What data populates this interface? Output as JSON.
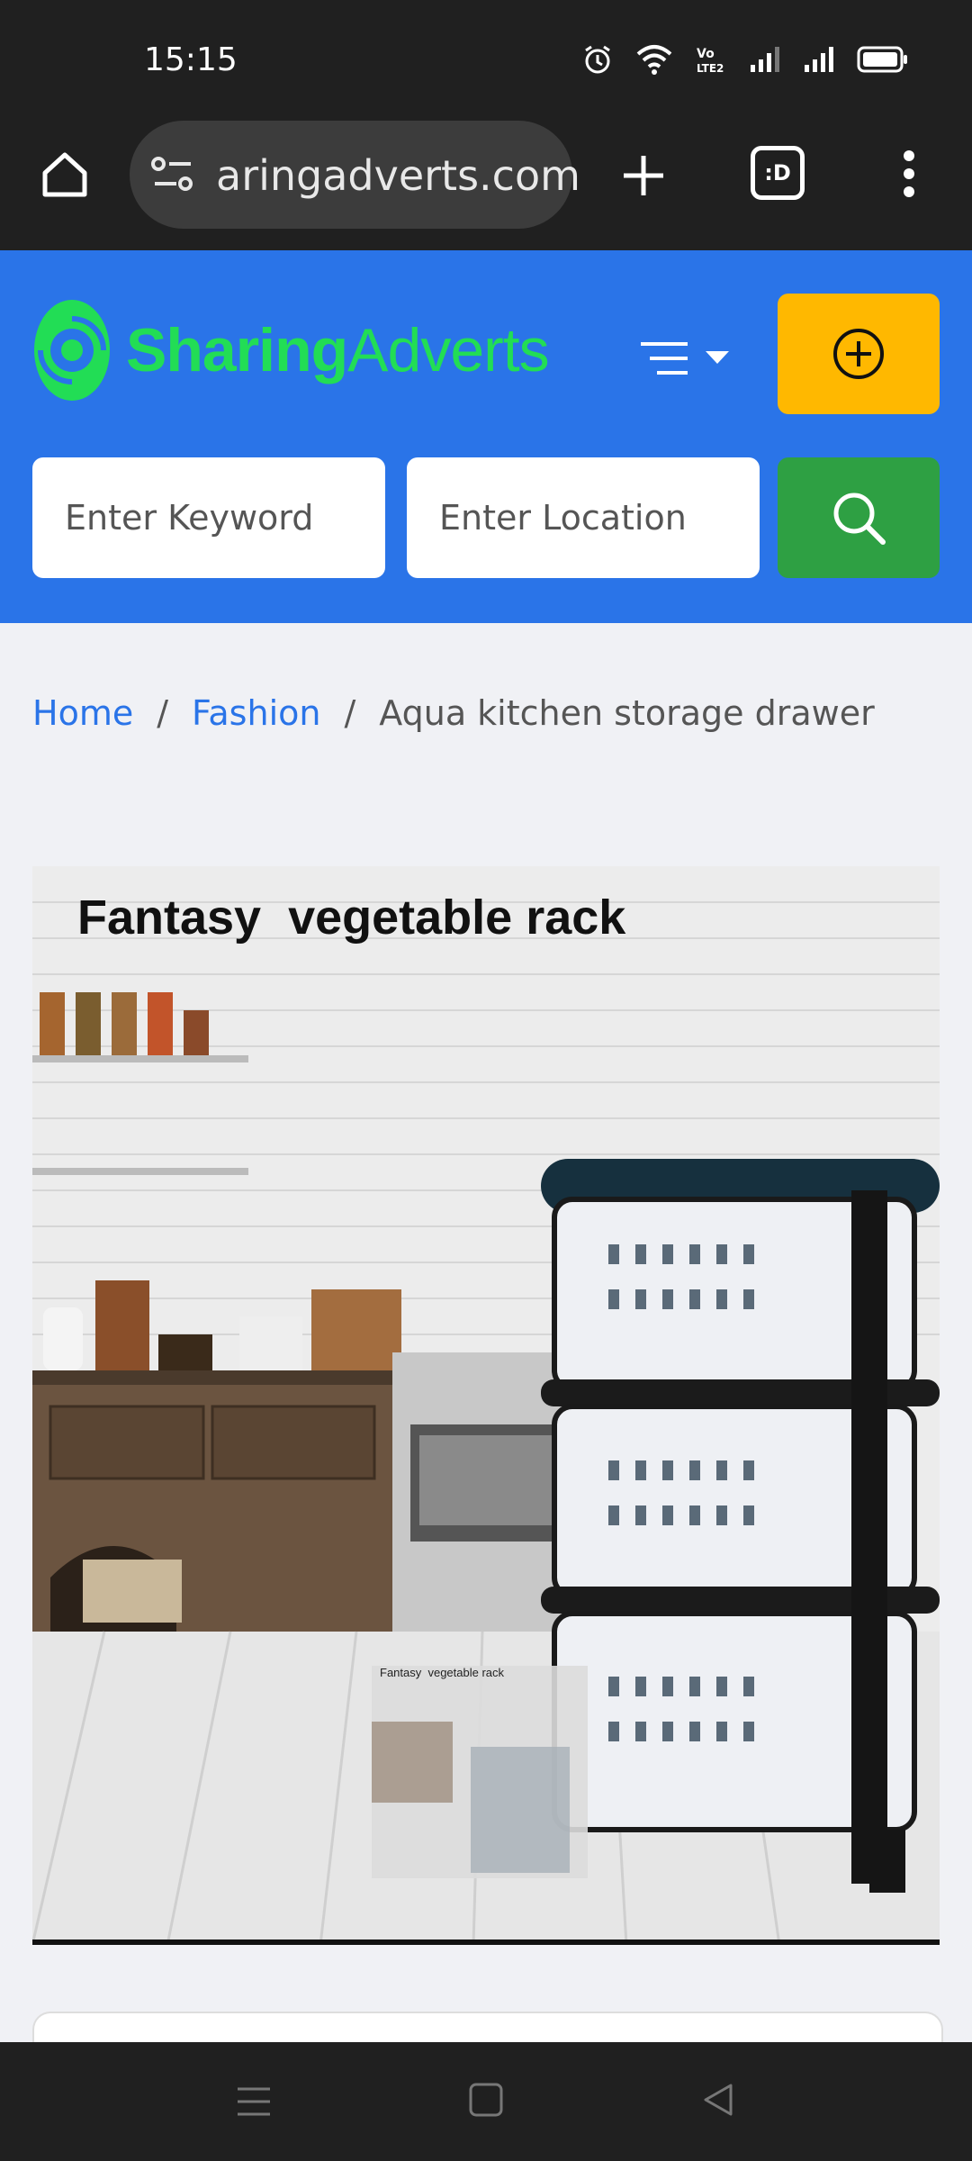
{
  "status_bar": {
    "time": "15:15",
    "icons": [
      "alarm-icon",
      "wifi-icon",
      "volte-icon",
      "signal-icon",
      "signal-icon",
      "battery-icon"
    ]
  },
  "browser": {
    "url": "aringadverts.com",
    "tab_count_label": ":D",
    "icons": [
      "home-icon",
      "site-settings-icon",
      "new-tab-icon",
      "tabs-icon",
      "more-icon"
    ]
  },
  "header": {
    "logo_main": "Sharing",
    "logo_accent": "Adverts",
    "brand_color": "#2a74e8",
    "post_button_color": "#ffb800",
    "search_button_color": "#2ea043"
  },
  "search": {
    "keyword_placeholder": "Enter Keyword",
    "location_placeholder": "Enter Location"
  },
  "breadcrumb": {
    "home": "Home",
    "separator": "/",
    "category": "Fashion",
    "current": "Aqua kitchen storage drawer"
  },
  "product": {
    "image_caption": "Fantasy  vegetable rack",
    "thumb_caption": "Fantasy  vegetable rack"
  }
}
